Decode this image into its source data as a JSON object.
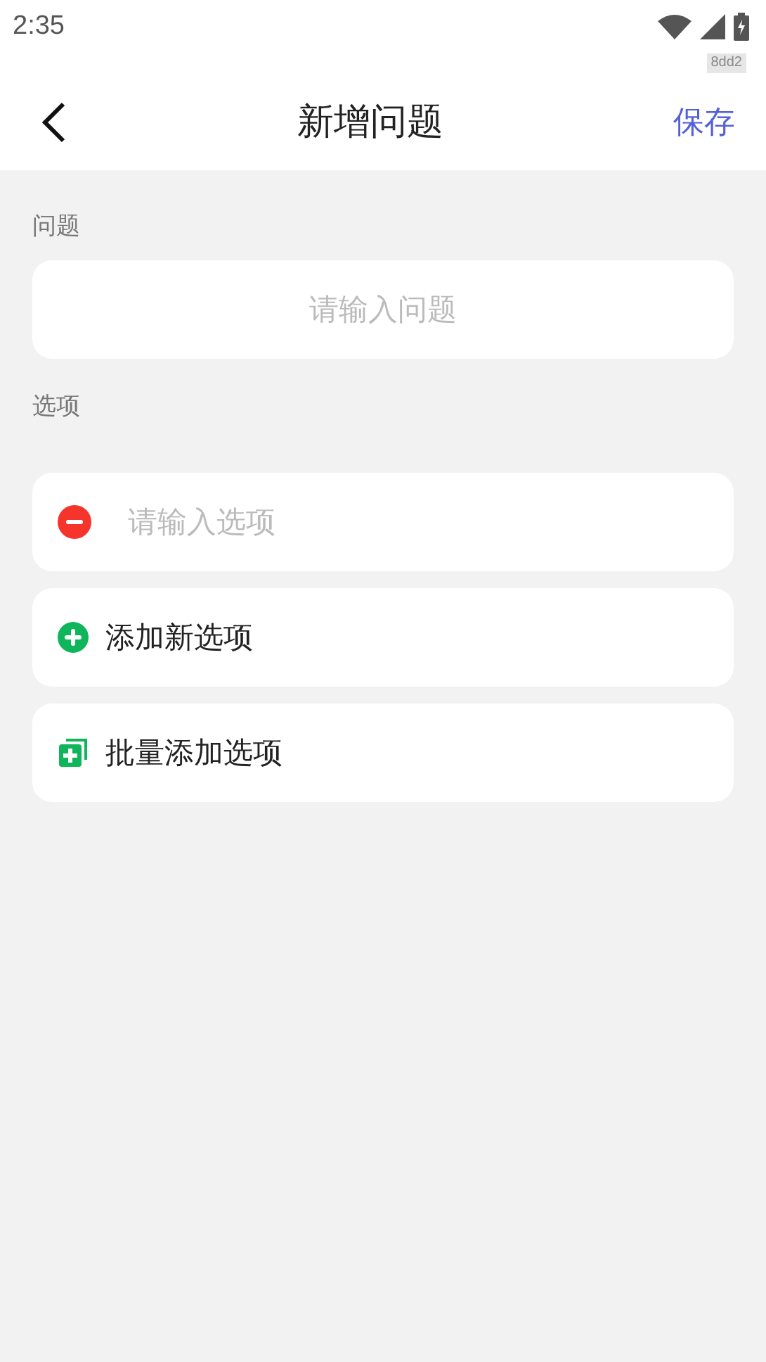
{
  "status_bar": {
    "time": "2:35",
    "badge": "8dd2"
  },
  "header": {
    "title": "新增问题",
    "save": "保存"
  },
  "question": {
    "label": "问题",
    "placeholder": "请输入问题"
  },
  "options": {
    "label": "选项",
    "items": [
      {
        "placeholder": "请输入选项"
      }
    ],
    "actions": [
      {
        "kind": "add",
        "label": "添加新选项"
      },
      {
        "kind": "batch",
        "label": "批量添加选项"
      }
    ]
  }
}
